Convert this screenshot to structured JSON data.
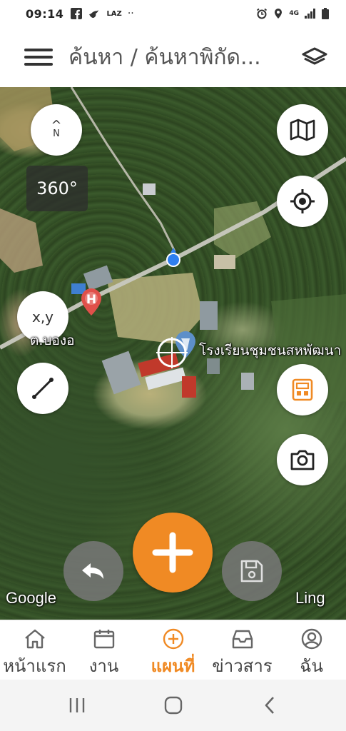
{
  "status_bar": {
    "time": "09:14",
    "left_icons": [
      "facebook-icon",
      "bird-icon",
      "lazada-icon",
      "more-dots-icon"
    ],
    "lazada_text": "LAZ",
    "more_text": "··",
    "network_text": "4G",
    "right_icons": [
      "alarm-icon",
      "location-icon",
      "4g-icon",
      "signal-icon",
      "battery-icon"
    ]
  },
  "header": {
    "title": "ค้นหา / ค้นหาพิกัด..."
  },
  "map": {
    "compass_label": "N",
    "heading": "360°",
    "xy_label": "x,y",
    "hospital_marker": "H",
    "hospital_label": "ต.บองอ",
    "school_label": "โรงเรียนชุมชนสหพัฒนา",
    "google_logo": "Google",
    "ling_label": "Ling"
  },
  "tabs": [
    {
      "label": "หน้าแรก",
      "icon": "home-icon",
      "active": false
    },
    {
      "label": "งาน",
      "icon": "calendar-icon",
      "active": false
    },
    {
      "label": "แผนที่",
      "icon": "add-circle-icon",
      "active": true
    },
    {
      "label": "ข่าวสาร",
      "icon": "inbox-icon",
      "active": false
    },
    {
      "label": "ฉัน",
      "icon": "user-icon",
      "active": false
    }
  ],
  "colors": {
    "accent": "#f08a24",
    "text_dark": "#333333",
    "map_button_bg": "#ffffff",
    "location_dot": "#2f7ff0"
  }
}
